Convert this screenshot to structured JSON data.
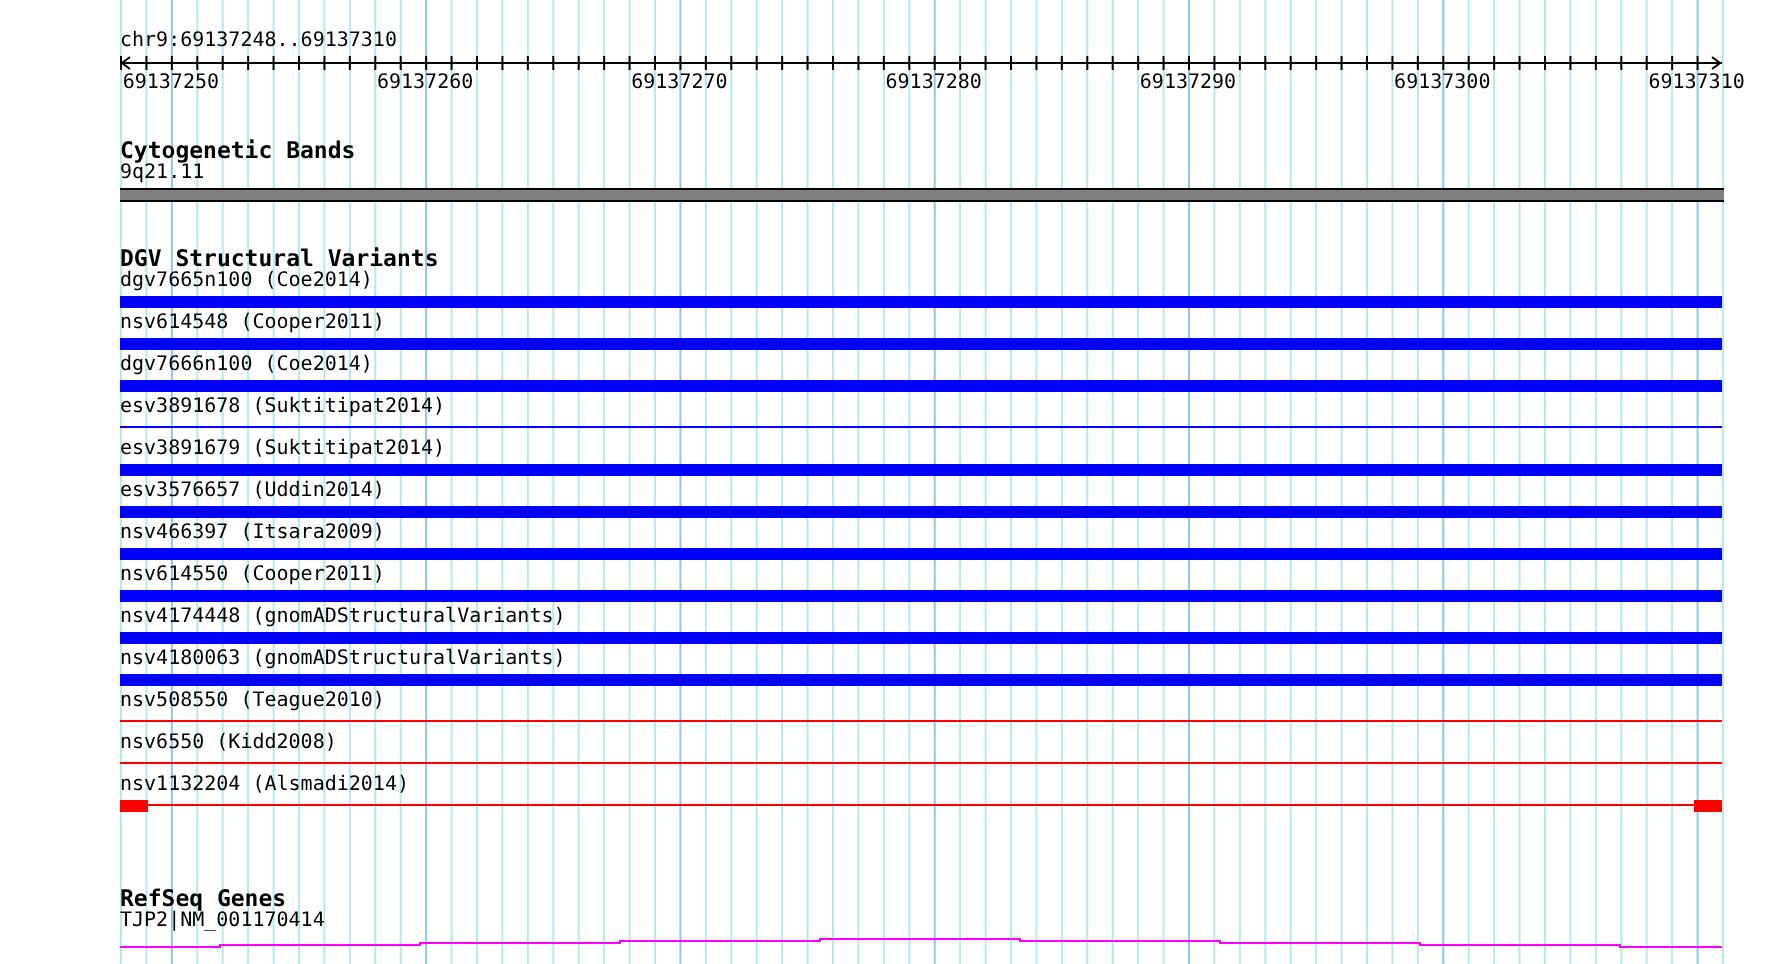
{
  "ruler": {
    "region": "chr9:69137248..69137310",
    "ticks": [
      "69137250",
      "69137260",
      "69137270",
      "69137280",
      "69137290",
      "69137300",
      "69137310"
    ]
  },
  "tracks": [
    {
      "kind": "bands",
      "title": "Cytogenetic Bands",
      "features": [
        {
          "label": "9q21.11"
        }
      ]
    },
    {
      "kind": "variants",
      "title": "DGV Structural Variants",
      "features": [
        {
          "label": "dgv7665n100 (Coe2014)",
          "kind": "thick",
          "color": "#0000ff"
        },
        {
          "label": "nsv614548 (Cooper2011)",
          "kind": "thick",
          "color": "#0000ff"
        },
        {
          "label": "dgv7666n100 (Coe2014)",
          "kind": "thick",
          "color": "#0000ff"
        },
        {
          "label": "esv3891678 (Suktitipat2014)",
          "kind": "thin",
          "color": "#0000ff"
        },
        {
          "label": "esv3891679 (Suktitipat2014)",
          "kind": "thick",
          "color": "#0000ff"
        },
        {
          "label": "esv3576657 (Uddin2014)",
          "kind": "thick",
          "color": "#0000ff"
        },
        {
          "label": "nsv466397 (Itsara2009)",
          "kind": "thick",
          "color": "#0000ff"
        },
        {
          "label": "nsv614550 (Cooper2011)",
          "kind": "thick",
          "color": "#0000ff"
        },
        {
          "label": "nsv4174448 (gnomADStructuralVariants)",
          "kind": "thick",
          "color": "#0000ff"
        },
        {
          "label": "nsv4180063 (gnomADStructuralVariants)",
          "kind": "thick",
          "color": "#0000ff"
        },
        {
          "label": "nsv508550 (Teague2010)",
          "kind": "thin",
          "color": "#ff0000"
        },
        {
          "label": "nsv6550 (Kidd2008)",
          "kind": "thin",
          "color": "#ff0000"
        },
        {
          "label": "nsv1132204 (Alsmadi2014)",
          "kind": "ends",
          "color": "#ff0000"
        }
      ]
    },
    {
      "kind": "genes",
      "title": "RefSeq Genes",
      "features": [
        {
          "label": "TJP2|NM_001170414"
        }
      ]
    }
  ]
}
